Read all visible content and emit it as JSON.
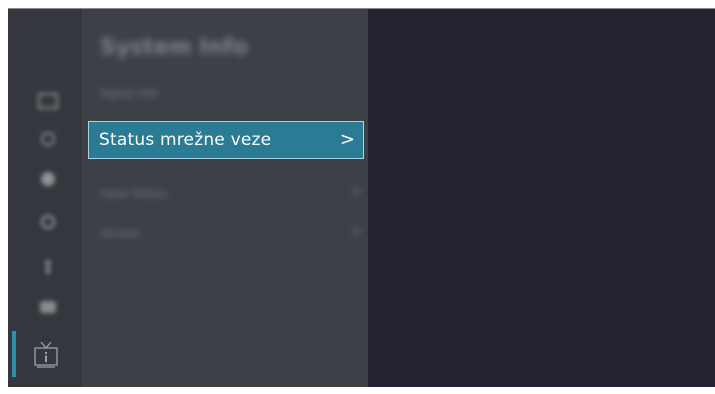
{
  "menu": {
    "title": "System Info",
    "items": [
      {
        "label": "Signal Info",
        "chevron": ""
      },
      {
        "label": "Status mrežne veze",
        "chevron": ">"
      },
      {
        "label": "Input Status",
        "chevron": ">"
      },
      {
        "label": "Version",
        "chevron": ">"
      }
    ]
  },
  "sidebar": {
    "icons": [
      "picture-icon",
      "sound-icon",
      "network-icon",
      "channel-icon",
      "accessibility-icon",
      "apps-icon",
      "support-icon"
    ],
    "selected": "support-icon"
  },
  "colors": {
    "highlight": "#2a7b93",
    "accent": "#2f8fa6",
    "background": "#232230"
  }
}
